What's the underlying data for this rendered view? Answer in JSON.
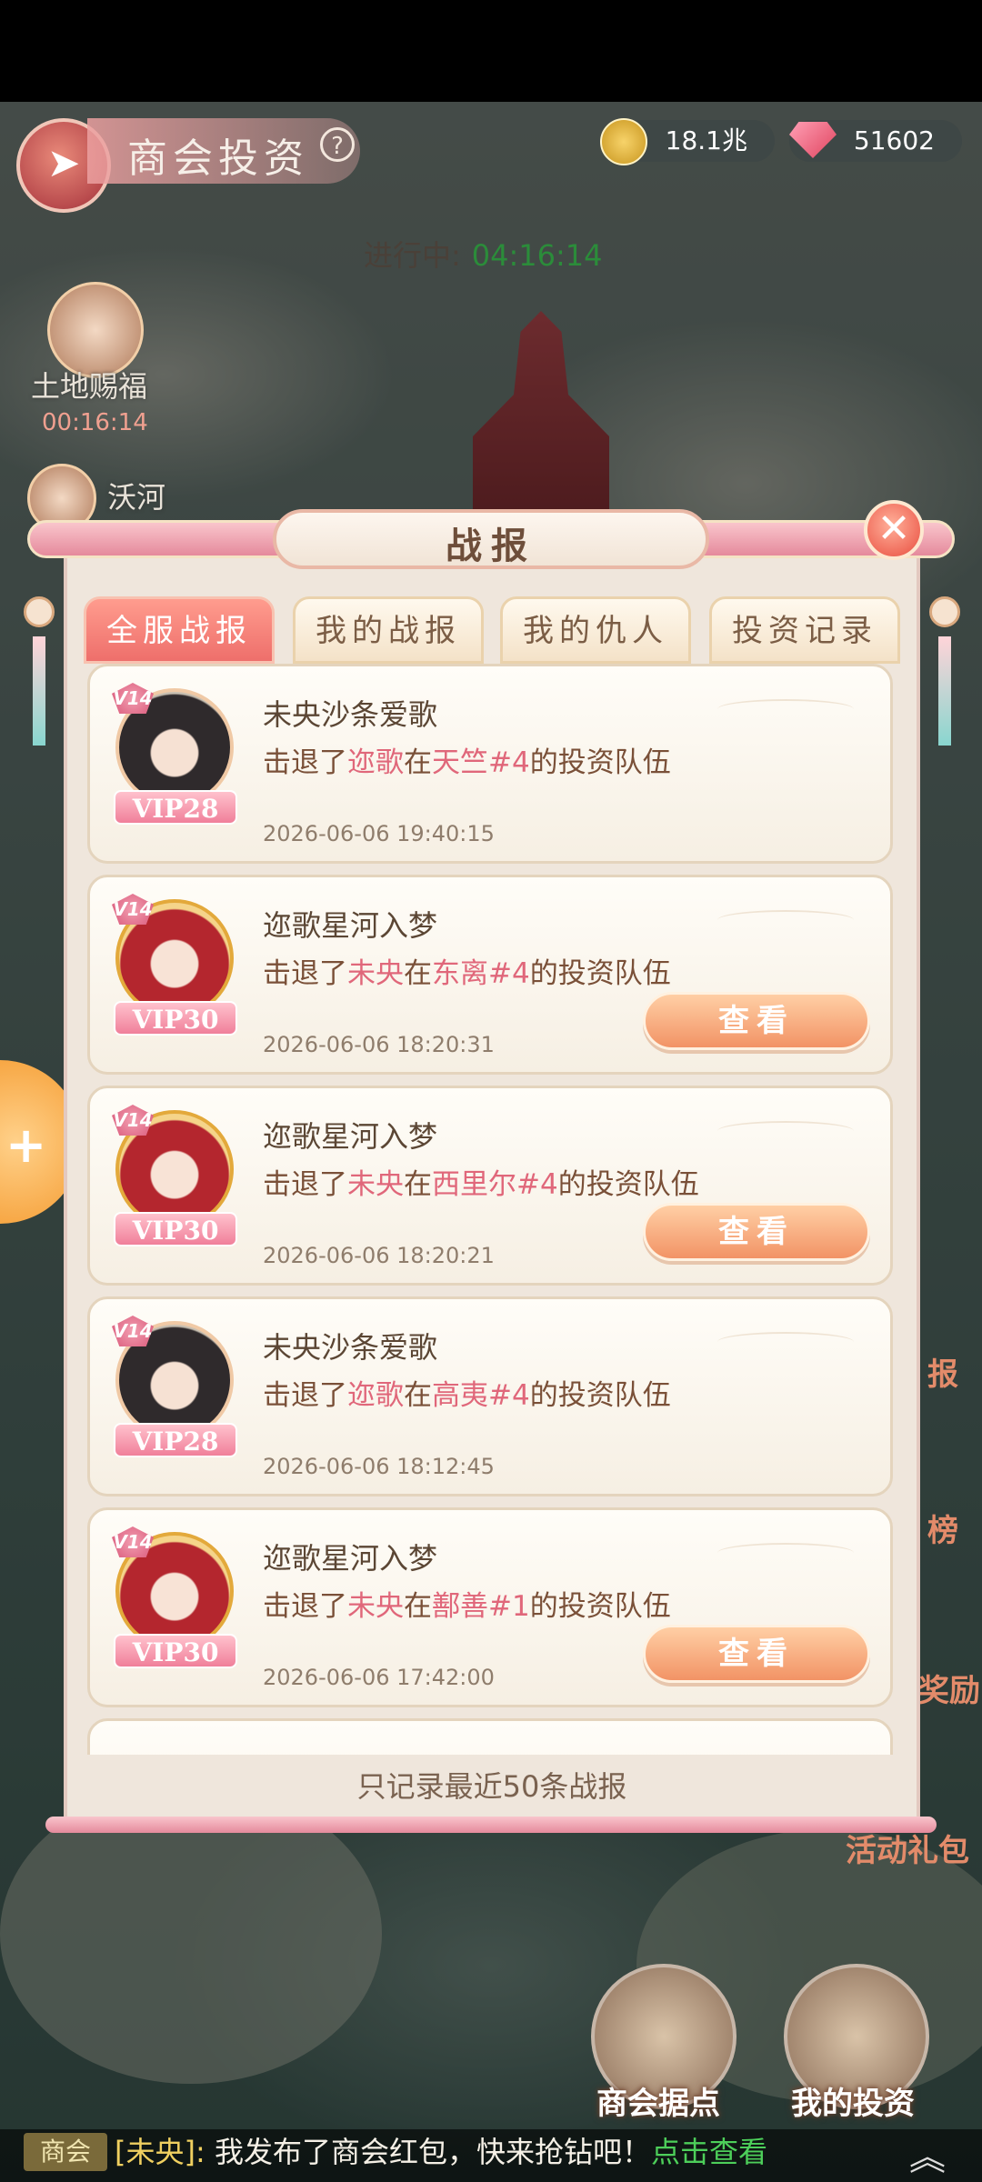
{
  "top_bar": {
    "title": "商会投资",
    "help": "?",
    "gold": "18.1兆",
    "diamonds": "51602"
  },
  "status": {
    "label": "进行中:",
    "countdown": "04:16:14"
  },
  "side_event": {
    "label": "土地赐福",
    "timer": "00:16:14",
    "secondary_label": "沃河"
  },
  "modal": {
    "title": "战报",
    "close_icon": "✕",
    "tabs": [
      {
        "label": "全服战报",
        "active": true
      },
      {
        "label": "我的战报",
        "active": false
      },
      {
        "label": "我的仇人",
        "active": false
      },
      {
        "label": "投资记录",
        "active": false
      }
    ],
    "reports": [
      {
        "name": "未央沙条爱歌",
        "v_level": "V14",
        "vip": "VIP28",
        "avatar": "dark",
        "action_prefix": "击退了",
        "target": "迩歌",
        "mid": "在",
        "location": "天竺#4",
        "suffix": "的投资队伍",
        "time": "2026-06-06 19:40:15",
        "has_view": false
      },
      {
        "name": "迩歌星河入梦",
        "v_level": "V14",
        "vip": "VIP30",
        "avatar": "red",
        "action_prefix": "击退了",
        "target": "未央",
        "mid": "在",
        "location": "东离#4",
        "suffix": "的投资队伍",
        "time": "2026-06-06 18:20:31",
        "has_view": true
      },
      {
        "name": "迩歌星河入梦",
        "v_level": "V14",
        "vip": "VIP30",
        "avatar": "red",
        "action_prefix": "击退了",
        "target": "未央",
        "mid": "在",
        "location": "西里尔#4",
        "suffix": "的投资队伍",
        "time": "2026-06-06 18:20:21",
        "has_view": true
      },
      {
        "name": "未央沙条爱歌",
        "v_level": "V14",
        "vip": "VIP28",
        "avatar": "dark",
        "action_prefix": "击退了",
        "target": "迩歌",
        "mid": "在",
        "location": "高夷#4",
        "suffix": "的投资队伍",
        "time": "2026-06-06 18:12:45",
        "has_view": false
      },
      {
        "name": "迩歌星河入梦",
        "v_level": "V14",
        "vip": "VIP30",
        "avatar": "red",
        "action_prefix": "击退了",
        "target": "未央",
        "mid": "在",
        "location": "鄯善#1",
        "suffix": "的投资队伍",
        "time": "2026-06-06 17:42:00",
        "has_view": true
      }
    ],
    "view_label": "查看",
    "footer_note": "只记录最近50条战报"
  },
  "right_icons": [
    "报",
    "榜",
    "奖励",
    "活动礼包"
  ],
  "bottom_buttons": [
    {
      "label": "商会据点"
    },
    {
      "label": "我的投资"
    }
  ],
  "chat": {
    "tag": "商会",
    "sender": "[未央]:",
    "message": " 我发布了商会红包，快来抢钻吧！",
    "link": "点击查看",
    "expand_icon": "︽"
  }
}
